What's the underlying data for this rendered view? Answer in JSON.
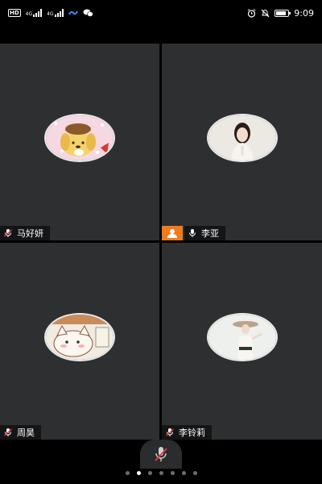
{
  "status_bar": {
    "hd_label": "HD",
    "net_1": "4G",
    "net_2": "4G",
    "time": "9:09",
    "battery_level": 0.85
  },
  "participants": [
    {
      "name": "马好妍",
      "mic": "muted-mic-icon",
      "is_host": false,
      "avatar": "pompompurin-avatar"
    },
    {
      "name": "李亚",
      "mic": "mic-icon",
      "is_host": true,
      "avatar": "woman-portrait-avatar"
    },
    {
      "name": "周昊",
      "mic": "muted-mic-icon",
      "is_host": false,
      "avatar": "cartoon-cat-avatar"
    },
    {
      "name": "李铃莉",
      "mic": "muted-mic-icon",
      "is_host": false,
      "avatar": "woman-hat-avatar"
    }
  ],
  "bottom": {
    "mute_icon": "muted-mic-icon",
    "page_count": 7,
    "active_page_index": 1
  },
  "colors": {
    "tile_bg": "#2d2f31",
    "host_badge": "#f07a1e",
    "mute_red": "#e23b3b"
  }
}
